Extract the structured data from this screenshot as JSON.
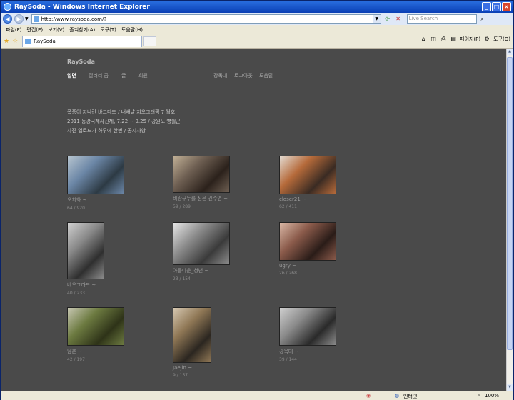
{
  "window": {
    "title": "RaySoda - Windows Internet Explorer"
  },
  "address": {
    "url": "http://www.raysoda.com/?"
  },
  "search": {
    "placeholder": "Live Search"
  },
  "menu": [
    "파일(F)",
    "편집(E)",
    "보기(V)",
    "즐겨찾기(A)",
    "도구(T)",
    "도움말(H)"
  ],
  "tab": {
    "label": "RaySoda"
  },
  "toolbar": {
    "page_label": "페이지(P)",
    "tools_label": "도구(O)"
  },
  "status": {
    "zone": "인터넷",
    "zoom": "100%"
  },
  "site": {
    "logo": "RaySoda",
    "nav": [
      "일면",
      "갤러리 곰",
      "글",
      "회원",
      "강목대",
      "로그아웃",
      "도움말"
    ],
    "notice": [
      "폭풍이 지나간 바그다드 / 내새날 지오그래픽 7 월호",
      "2011 동강국제사진제, 7.22 ~ 9.25 / 강원도 영월군",
      "사진 업로드가 하루에 한번 / 공지사항"
    ],
    "photos": [
      {
        "title": "오치화 ~",
        "stats": "64 / 920",
        "colors": [
          "#6b86a6",
          "#2d3a44",
          "#b6c4cf"
        ]
      },
      {
        "title": "비랑구두를 신은 긴수염 ~",
        "stats": "59 / 289",
        "colors": [
          "#6e5f52",
          "#2b211b",
          "#bfae94"
        ]
      },
      {
        "title": "closer21 ~",
        "stats": "62 / 411",
        "colors": [
          "#b56a3a",
          "#3a2b23",
          "#e3dad0"
        ]
      },
      {
        "title": "베오그라드 ~",
        "stats": "40 / 233",
        "colors": [
          "#8a8a8a",
          "#2f2f2f",
          "#d0d0d0"
        ]
      },
      {
        "title": "아름다운_청년 ~",
        "stats": "23 / 154",
        "colors": [
          "#8c8c8c",
          "#3a3a3a",
          "#e6e6e6"
        ]
      },
      {
        "title": "ugry ~",
        "stats": "26 / 268",
        "colors": [
          "#8a5a4a",
          "#2a1c18",
          "#d9b7a5"
        ]
      },
      {
        "title": "남촌 ~",
        "stats": "42 / 197",
        "colors": [
          "#6c7a40",
          "#2e3318",
          "#c7c7b2"
        ]
      },
      {
        "title": "Jaejin ~",
        "stats": "9 / 157",
        "colors": [
          "#8f7755",
          "#2b2620",
          "#d5c7b0"
        ]
      },
      {
        "title": "강목대 ~",
        "stats": "39 / 144",
        "colors": [
          "#8a8a8a",
          "#2a2a2a",
          "#cfcfcf"
        ]
      }
    ]
  }
}
